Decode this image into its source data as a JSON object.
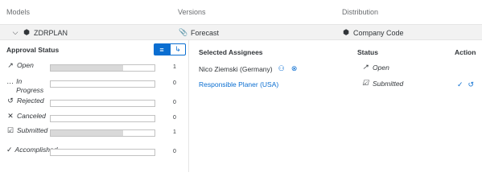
{
  "header": {
    "models": "Models",
    "versions": "Versions",
    "distribution": "Distribution"
  },
  "model_row": {
    "model": "ZDRPLAN",
    "version": "Forecast",
    "distribution": "Company Code"
  },
  "approval": {
    "title": "Approval Status",
    "statuses": [
      {
        "label": "Open",
        "count": "1",
        "fill": 0.7
      },
      {
        "label": "In Progress",
        "count": "0",
        "fill": 0
      },
      {
        "label": "Rejected",
        "count": "0",
        "fill": 0
      },
      {
        "label": "Canceled",
        "count": "0",
        "fill": 0
      },
      {
        "label": "Submitted",
        "count": "1",
        "fill": 0.7
      },
      {
        "label": "Accomplished",
        "count": "0",
        "fill": 0
      }
    ]
  },
  "table": {
    "headers": {
      "assignees": "Selected Assignees",
      "status": "Status",
      "action": "Action"
    },
    "rows": [
      {
        "assignee": "Nico Ziemski (Germany)",
        "status": "Open"
      },
      {
        "assignee": "Responsible Planer (USA)",
        "status": "Submitted"
      }
    ]
  }
}
